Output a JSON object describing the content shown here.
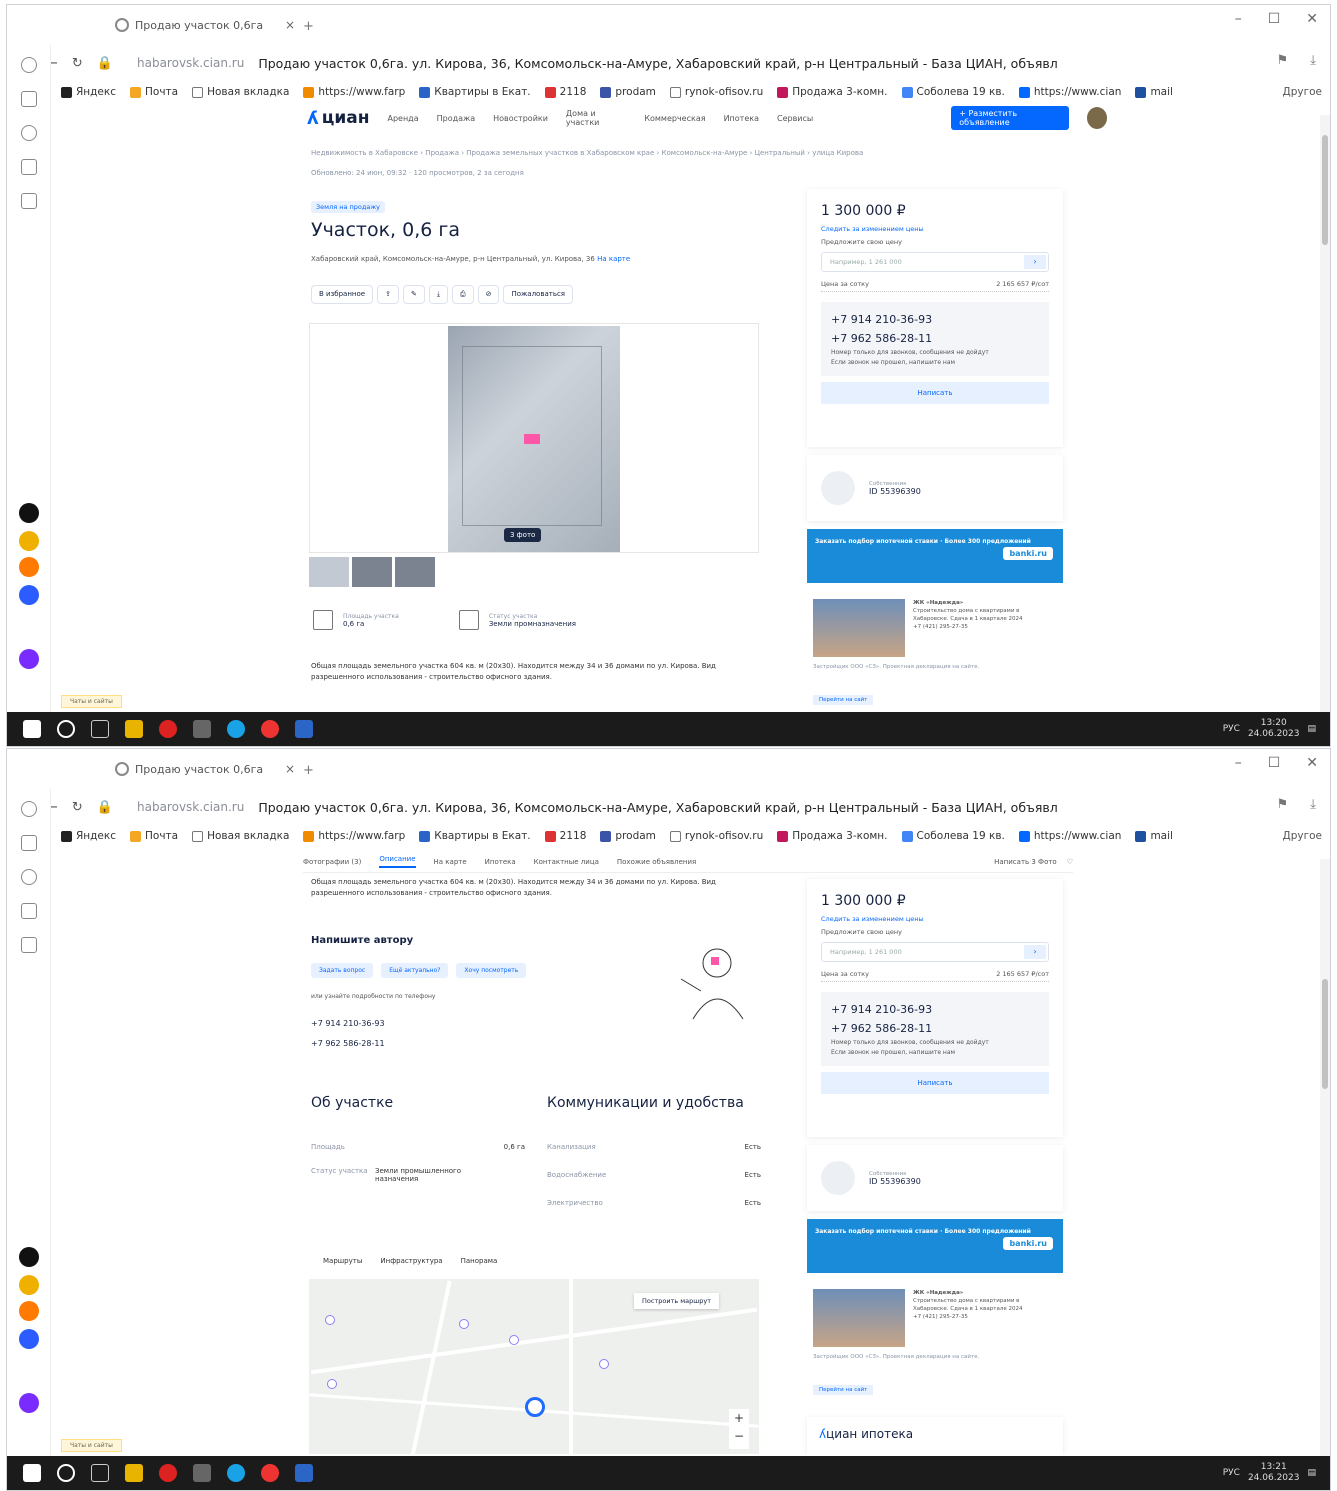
{
  "browser": {
    "tab_title": "Продаю участок 0,6га",
    "tab_close": "×",
    "new_tab": "+",
    "domain": "habarovsk.cian.ru",
    "page_title": "Продаю участок 0,6га. ул. Кирова, 36, Комсомольск-на-Амуре, Хабаровский край, р-н Центральный - База ЦИАН, объявлен...",
    "bookmarks": [
      "Яндекс",
      "Почта",
      "Новая вкладка",
      "https://www.farp",
      "Квартиры в Екат.",
      "2118",
      "prodam",
      "rynok-ofisov.ru",
      "Продажа 3-комн.",
      "Соболева 19 кв.",
      "https://www.cian",
      "mail"
    ],
    "bookmarks_other": "Другое"
  },
  "cian": {
    "logo": "циан",
    "nav": [
      "Аренда",
      "Продажа",
      "Новостройки",
      "Дома и участки",
      "Коммерческая",
      "Ипотека",
      "Сервисы"
    ],
    "place_ad": "+ Разместить объявление",
    "breadcrumbs": "Недвижимость в Хабаровске › Продажа › Продажа земельных участков в Хабаровском крае › Комсомольск-на-Амуре › Центральный › улица Кирова",
    "updated": "Обновлено: 24 июн, 09:32 · 120 просмотров, 2 за сегодня",
    "tag": "Земля на продажу",
    "title": "Участок, 0,6 га",
    "address": "Хабаровский край, Комсомольск-на-Амуре, р-н Центральный, ул. Кирова, 36",
    "address_link": "На карте",
    "actions": [
      "В избранное",
      "Пожаловаться"
    ],
    "photo_count": "3 фото",
    "facts": [
      {
        "label": "Площадь участка",
        "value": "0,6 га"
      },
      {
        "label": "Статус участка",
        "value": "Земли промназначения"
      }
    ],
    "description": "Общая площадь земельного участка 604 кв. м (20х30). Находится между 34 и 36 домами по ул. Кирова. Вид разрешенного использования - строительство офисного здания.",
    "price": "1 300 000 ₽",
    "price_watch": "Следить за изменением цены",
    "offer_label": "Предложите свою цену",
    "offer_placeholder": "Например, 1 261 000",
    "offer_go": "›",
    "per_meter_label": "Цена за сотку",
    "per_meter_value": "2 165 657 ₽/сот",
    "phone1": "+7 914 210-36-93",
    "phone2": "+7 962 586-28-11",
    "phone_note1": "Номер только для звонков, сообщения не дойдут",
    "phone_note2": "Если звонок не прошел, напишите нам",
    "write_button": "Написать",
    "agent_role": "Собственник",
    "agent_id": "ID 55396390",
    "banner_text": "Заказать подбор ипотечной ставки · Более 300 предложений",
    "banner_logo": "banki.ru",
    "advert_title": "ЖК «Надежда»",
    "advert_text": "Строительство дома с квартирами в Хабаровске. Сдача в 1 квартале 2024",
    "advert_phone": "+7 (421) 295-27-35",
    "advert_small": "Застройщик ООО «СЗ». Проектная декларация на сайте.",
    "advert_button": "Перейти на сайт",
    "chat": "Чаты и сайты",
    "anchors": [
      "Фотографии (3)",
      "Описание",
      "На карте",
      "Ипотека",
      "Контактные лица",
      "Похожие объявления"
    ],
    "anchors_right": "Написать 3 Фото",
    "write_header": "Напишите автору",
    "chips": [
      "Задать вопрос",
      "Ещё актуально?",
      "Хочу посмотреть"
    ],
    "or_phone": "или узнайте подробности по телефону",
    "about_header": "Об участке",
    "comm_header": "Коммуникации и удобства",
    "about_rows": [
      {
        "k": "Площадь",
        "v": "0,6 га"
      },
      {
        "k": "Статус участка",
        "v": "Земли промышленного назначения"
      }
    ],
    "comm_rows": [
      {
        "k": "Канализация",
        "v": "Есть"
      },
      {
        "k": "Водоснабжение",
        "v": "Есть"
      },
      {
        "k": "Электричество",
        "v": "Есть"
      }
    ],
    "map_tabs": [
      "Маршруты",
      "Инфраструктура",
      "Панорама"
    ],
    "map_route": "Построить маршрут",
    "mortgage": "циан ипотека"
  },
  "taskbar": {
    "lang": "РУС",
    "time1": "13:20",
    "time2": "13:21",
    "date": "24.06.2023"
  }
}
